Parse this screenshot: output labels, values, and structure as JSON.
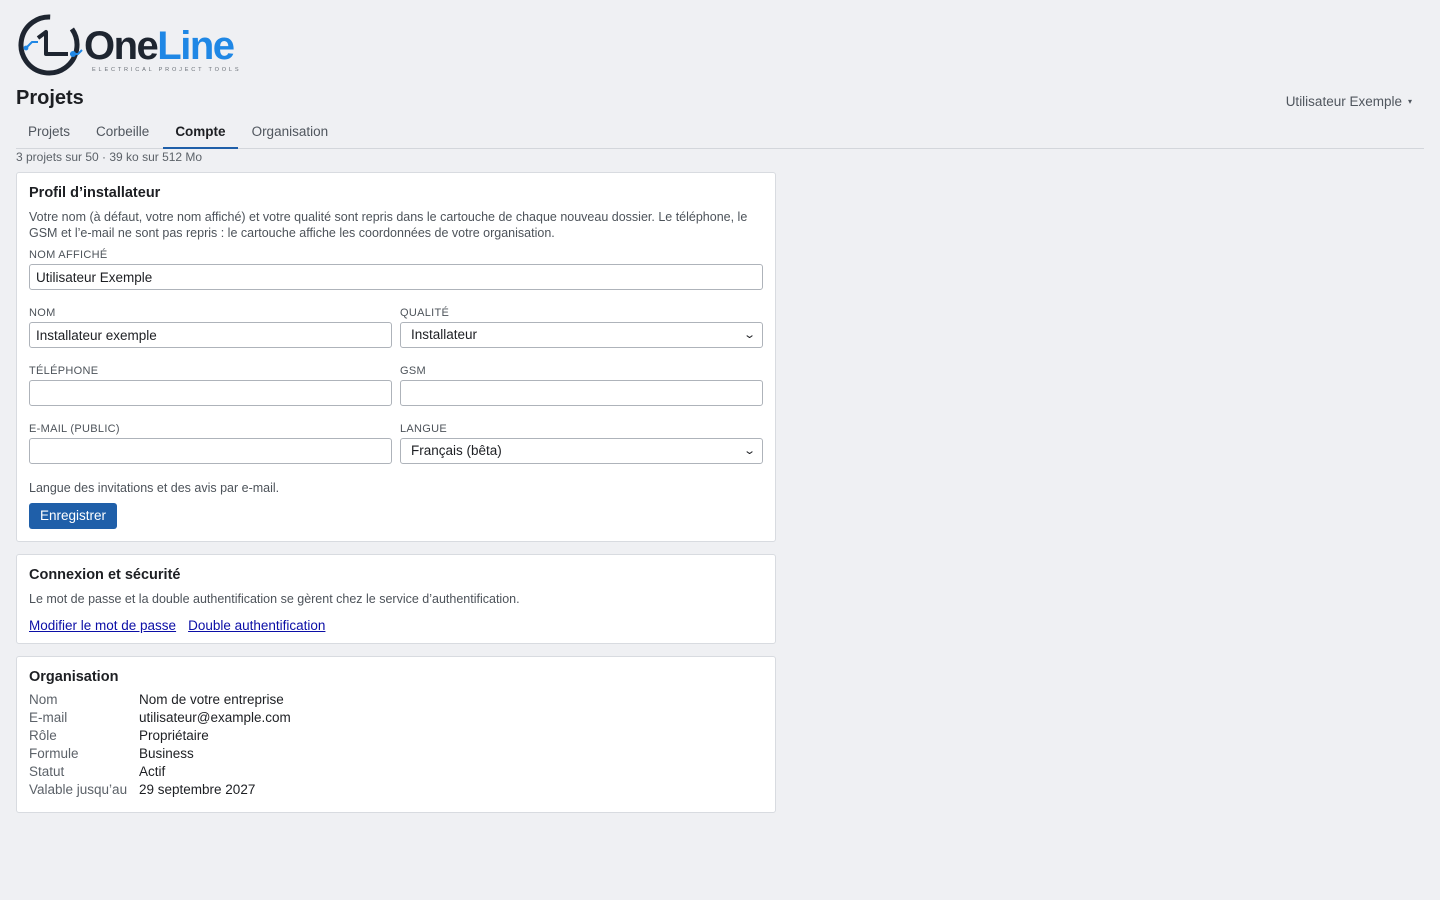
{
  "brand": {
    "name_part1": "One",
    "name_part2": "Line",
    "tagline": "ELECTRICAL PROJECT TOOLS",
    "color_dark": "#1e2530",
    "color_accent": "#1f87e5"
  },
  "header": {
    "title": "Projets",
    "user_name": "Utilisateur Exemple",
    "user_caret": "▾"
  },
  "tabs": [
    {
      "label": "Projets"
    },
    {
      "label": "Corbeille"
    },
    {
      "label": "Compte",
      "active": true
    },
    {
      "label": "Organisation"
    }
  ],
  "quota": "3 projets sur 50 · 39 ko sur 512 Mo",
  "profile": {
    "title": "Profil d’installateur",
    "description": "Votre nom (à défaut, votre nom affiché) et votre qualité sont repris dans le cartouche de chaque nouveau dossier. Le téléphone, le GSM et l’e-mail ne sont pas repris : le cartouche affiche les coordonnées de votre organisation.",
    "display_name_label": "Nom affiché",
    "display_name_value": "Utilisateur Exemple",
    "name_label": "Nom",
    "name_value": "Installateur exemple",
    "quality_label": "Qualité",
    "quality_value": "Installateur",
    "phone_label": "Téléphone",
    "phone_value": "",
    "gsm_label": "GSM",
    "gsm_value": "",
    "email_label": "E-mail (public)",
    "email_value": "",
    "language_label": "Langue",
    "language_value": "Français (bêta)",
    "language_hint": "Langue des invitations et des avis par e-mail.",
    "save_label": "Enregistrer"
  },
  "security": {
    "title": "Connexion et sécurité",
    "description": "Le mot de passe et la double authentification se gèrent chez le service d’authentification.",
    "change_password_link": "Modifier le mot de passe",
    "two_factor_link": "Double authentification"
  },
  "organisation": {
    "title": "Organisation",
    "rows": [
      {
        "key": "Nom",
        "value": "Nom de votre entreprise"
      },
      {
        "key": "E-mail",
        "value": "utilisateur@example.com"
      },
      {
        "key": "Rôle",
        "value": "Propriétaire"
      },
      {
        "key": "Formule",
        "value": "Business"
      },
      {
        "key": "Statut",
        "value": "Actif"
      },
      {
        "key": "Valable jusqu’au",
        "value": "29 septembre 2027"
      }
    ]
  },
  "colors": {
    "primary_button": "#1f5fa9",
    "link": "#0b0ea6",
    "page_background": "#eff0f3"
  }
}
